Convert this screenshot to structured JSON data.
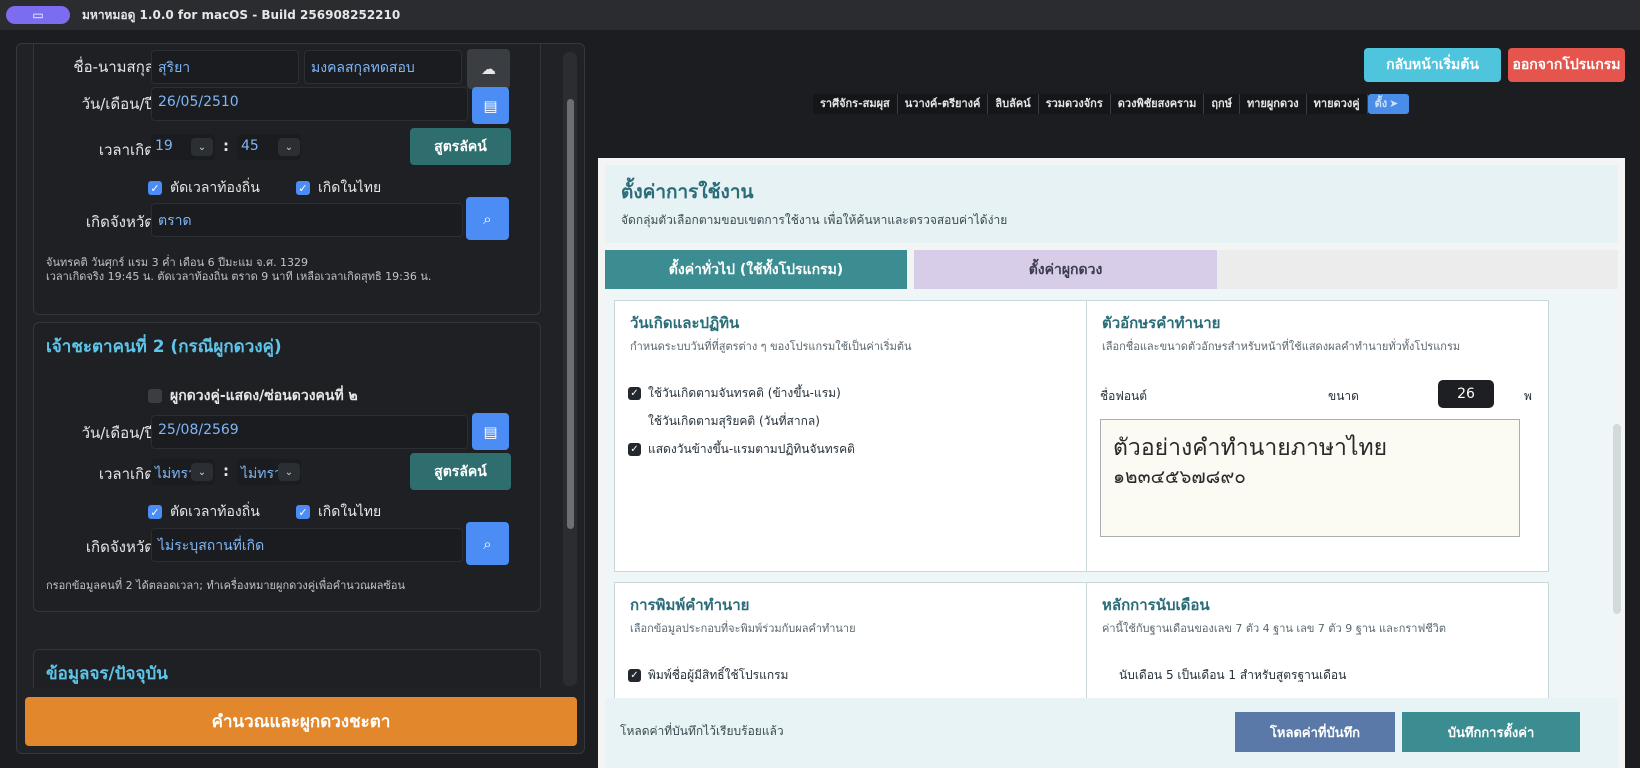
{
  "window": {
    "title": "มหาหมอดู 1.0.0 for macOS - Build 256908252210"
  },
  "person1": {
    "name_label": "ชื่อ-นามสกุล",
    "first_name": "สุริยา",
    "last_name": "มงคลสกุลทดสอบ",
    "date_label": "วัน/เดือน/ปี",
    "date": "26/05/2510",
    "time_label": "เวลาเกิด",
    "hour": "19",
    "minute": "45",
    "calc_button": "สูตรลัคน์",
    "local_time": "ตัดเวลาท้องถิ่น",
    "born_thai": "เกิดในไทย",
    "province_label": "เกิดจังหวัด",
    "province": "ตราด",
    "note_line1": "จันทรคติ วันศุกร์ แรม 3 ค่ำ เดือน 6 ปีมะแม จ.ศ. 1329",
    "note_line2": "เวลาเกิดจริง 19:45 น. ตัดเวลาท้องถิ่น ตราด 9 นาที เหลือเวลาเกิดสุทธิ 19:36 น."
  },
  "person2": {
    "section_title": "เจ้าชะตาคนที่ 2 (กรณีผูกดวงคู่)",
    "toggle": "ผูกดวงคู่-แสดง/ซ่อนดวงคนที่ ๒",
    "date_label": "วัน/เดือน/ปี",
    "date": "25/08/2569",
    "time_label": "เวลาเกิด",
    "hour": "ไม่ทรา",
    "minute": "ไม่ทรา",
    "calc_button": "สูตรลัคน์",
    "local_time": "ตัดเวลาท้องถิ่น",
    "born_thai": "เกิดในไทย",
    "province_label": "เกิดจังหวัด",
    "province": "ไม่ระบุสถานที่เกิด",
    "note": "กรอกข้อมูลคนที่ 2 ได้ตลอดเวลา; ทำเครื่องหมายผูกดวงคู่เพื่อคำนวณผลซ้อน"
  },
  "transit": {
    "section_title": "ข้อมูลจร/ปัจจุบัน"
  },
  "calculate_button": "คำนวณและผูกดวงชะตา",
  "top_buttons": {
    "home": "กลับหน้าเริ่มต้น",
    "exit": "ออกจากโปรแกรม"
  },
  "nav_tabs": [
    "ราศีจักร-สมผุส",
    "นวางค์-ตรียางค์",
    "ลิบลัคน์",
    "รวมดวงจักร",
    "ดวงพิชัยสงคราม",
    "ฤกษ์",
    "ทายผูกดวง",
    "ทายดวงคู่",
    "ตั้ง"
  ],
  "settings": {
    "title": "ตั้งค่าการใช้งาน",
    "subtitle": "จัดกลุ่มตัวเลือกตามขอบเขตการใช้งาน เพื่อให้ค้นหาและตรวจสอบค่าได้ง่าย",
    "tab_general": "ตั้งค่าทั่วไป (ใช้ทั้งโปรแกรม)",
    "tab_chart": "ตั้งค่าผูกดวง",
    "birthday": {
      "title": "วันเกิดและปฏิทิน",
      "desc": "กำหนดระบบวันที่ที่สูตรต่าง ๆ ของโปรแกรมใช้เป็นค่าเริ่มต้น",
      "opt1": "ใช้วันเกิดตามจันทรคติ (ข้างขึ้น-แรม)",
      "opt2": "ใช้วันเกิดตามสุริยคติ (วันที่สากล)",
      "opt3": "แสดงวันข้างขึ้น-แรมตามปฏิทินจันทรคติ"
    },
    "font": {
      "title": "ตัวอักษรคำทำนาย",
      "desc": "เลือกชื่อและขนาดตัวอักษรสำหรับหน้าที่ใช้แสดงผลคำทำนายทั่วทั้งโปรแกรม",
      "font_label": "ชื่อฟอนต์",
      "size_label": "ขนาด",
      "size": "26",
      "unit": "พ",
      "preview1": "ตัวอย่างคำทำนายภาษาไทย",
      "preview2": "๑๒๓๔๕๖๗๘๙๐"
    },
    "print": {
      "title": "การพิมพ์คำทำนาย",
      "desc": "เลือกข้อมูลประกอบที่จะพิมพ์ร่วมกับผลคำทำนาย",
      "opt1": "พิมพ์ชื่อผู้มีสิทธิ์ใช้โปรแกรม"
    },
    "month": {
      "title": "หลักการนับเดือน",
      "desc": "ค่านี้ใช้กับฐานเดือนของเลข 7 ตัว 4 ฐาน เลข 7 ตัว 9 ฐาน และกราฟชีวิต",
      "text1": "นับเดือน 5 เป็นเดือน 1 สำหรับสูตรฐานเดือน"
    },
    "footer_msg": "โหลดค่าที่บันทึกไว้เรียบร้อยแล้ว",
    "load_button": "โหลดค่าที่บันทึก",
    "save_button": "บันทึกการตั้งค่า"
  }
}
